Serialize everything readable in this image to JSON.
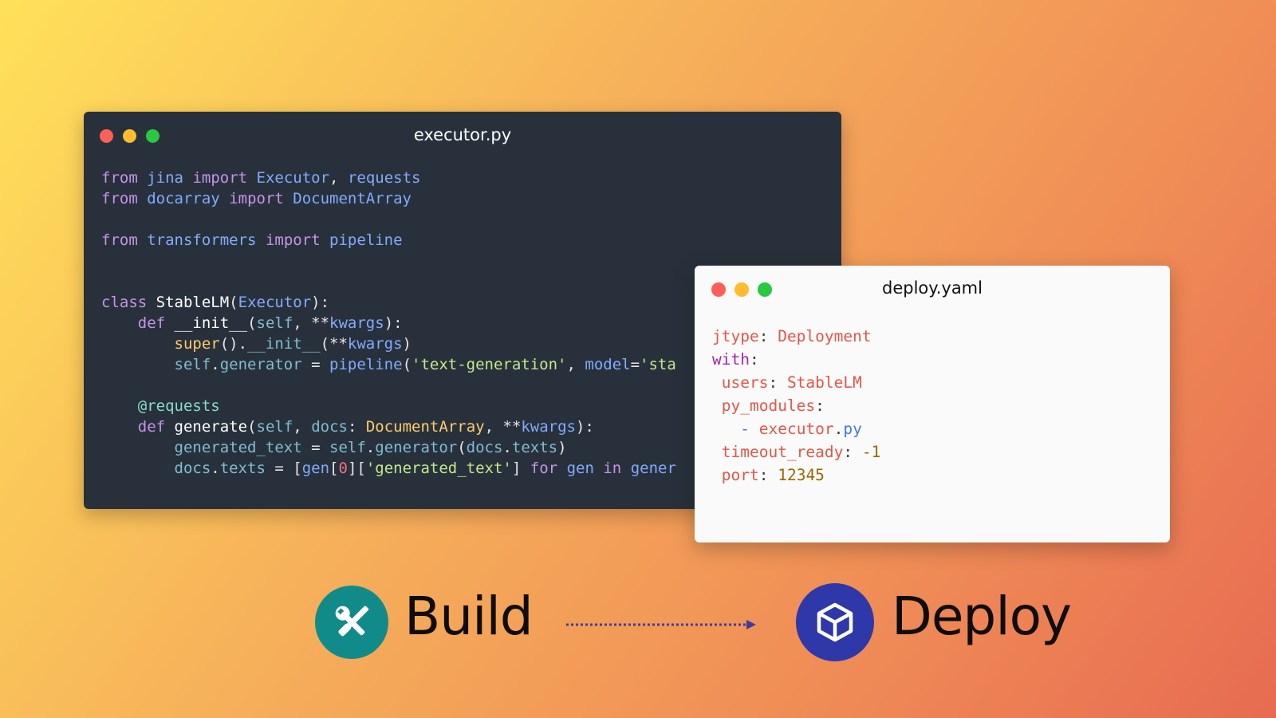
{
  "executor_window": {
    "title": "executor.py",
    "code_lines": [
      "from jina import Executor, requests",
      "from docarray import DocumentArray",
      "",
      "from transformers import pipeline",
      "",
      "",
      "class StableLM(Executor):",
      "    def __init__(self, **kwargs):",
      "        super().__init__(**kwargs)",
      "        self.generator = pipeline('text-generation', model='sta",
      "",
      "    @requests",
      "    def generate(self, docs: DocumentArray, **kwargs):",
      "        generated_text = self.generator(docs.texts)",
      "        docs.texts = [gen[0]['generated_text'] for gen in gener"
    ]
  },
  "deploy_window": {
    "title": "deploy.yaml",
    "code_lines": [
      "jtype: Deployment",
      "with:",
      " users: StableLM",
      " py_modules:",
      "   - executor.py",
      " timeout_ready: -1",
      " port: 12345"
    ]
  },
  "flow": {
    "build_label": "Build",
    "deploy_label": "Deploy",
    "build_icon": "tools-icon",
    "deploy_icon": "cube-icon",
    "build_color": "#118b8a",
    "deploy_color": "#2f38a8",
    "arrow_color": "#3b3f9a"
  }
}
